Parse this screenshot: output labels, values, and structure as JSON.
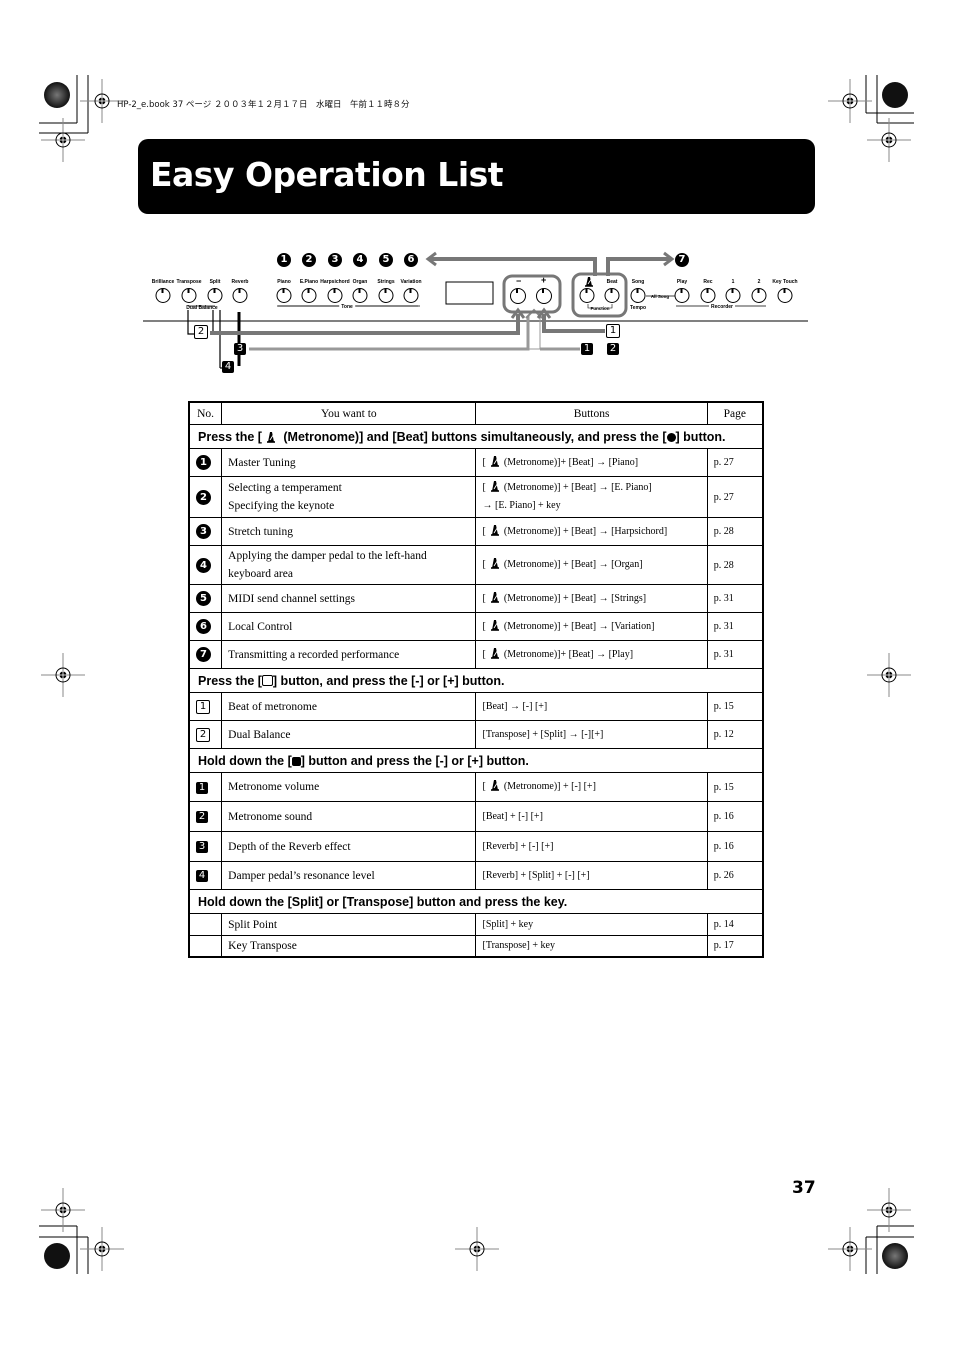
{
  "print_header": "HP-2_e.book  37 ページ  ２００３年１２月１７日　水曜日　午前１１時８分",
  "title": "Easy Operation List",
  "page_number": "37",
  "panel": {
    "left_knobs": [
      "Brilliance",
      "Transpose",
      "Split",
      "Reverb"
    ],
    "left_group_label": "Dual Balance",
    "tone_knobs": [
      "Piano",
      "E.Piano",
      "Harpsichord",
      "Organ",
      "Strings",
      "Variation"
    ],
    "tone_group_label": "Tone",
    "minus_label": "−",
    "plus_label": "+",
    "beat_label": "Beat",
    "function_label": "Function",
    "song_label": "Song",
    "tempo_label": "Tempo",
    "allsong_label": "All Song",
    "recorder_knobs": [
      "Play",
      "Rec",
      "1",
      "2"
    ],
    "recorder_group_label": "Recorder",
    "key_touch_label": "Key Touch",
    "callout_numbers": [
      "1",
      "2",
      "3",
      "4",
      "5",
      "6"
    ],
    "callout_7": "7",
    "callout_outline": [
      "2",
      "1"
    ],
    "callout_filled": [
      "3",
      "4",
      "1",
      "2"
    ]
  },
  "table": {
    "headers": [
      "No.",
      "You want to",
      "Buttons",
      "Page"
    ],
    "sections": [
      {
        "title_pre": "Press the [",
        "title_mid": " (Metronome)] and [Beat] buttons simultaneously, and press the [",
        "title_post": "] button.",
        "rows": [
          {
            "no": "1",
            "want": [
              "Master Tuning"
            ],
            "buttons": [
              "(Metronome)]+ [Beat] → [Piano]"
            ],
            "page": "p. 27"
          },
          {
            "no": "2",
            "want": [
              "Selecting a temperament",
              "Specifying the keynote"
            ],
            "buttons": [
              "(Metronome)] + [Beat] → [E. Piano]",
              "→ [E. Piano] + key"
            ],
            "page": "p. 27"
          },
          {
            "no": "3",
            "want": [
              "Stretch tuning"
            ],
            "buttons": [
              "(Metronome)] + [Beat] → [Harpsichord]"
            ],
            "page": "p. 28"
          },
          {
            "no": "4",
            "want": [
              "Applying the damper pedal to the left-hand",
              "keyboard area"
            ],
            "buttons": [
              "(Metronome)] + [Beat] → [Organ]"
            ],
            "page": "p. 28"
          },
          {
            "no": "5",
            "want": [
              "MIDI send channel settings"
            ],
            "buttons": [
              "(Metronome)] + [Beat] → [Strings]"
            ],
            "page": "p. 31"
          },
          {
            "no": "6",
            "want": [
              "Local Control"
            ],
            "buttons": [
              "(Metronome)] + [Beat] → [Variation]"
            ],
            "page": "p. 31"
          },
          {
            "no": "7",
            "want": [
              "Transmitting a recorded performance"
            ],
            "buttons": [
              "(Metronome)]+ [Beat] → [Play]"
            ],
            "page": "p. 31"
          }
        ]
      },
      {
        "title_pre": "Press the [",
        "title_post": "] button, and press the [-] or [+] button.",
        "rows": [
          {
            "no": "1",
            "want": [
              "Beat of metronome"
            ],
            "buttons": [
              "[Beat] → [-] [+]"
            ],
            "page": "p. 15"
          },
          {
            "no": "2",
            "want": [
              "Dual Balance"
            ],
            "buttons": [
              "[Transpose] + [Split] → [-][+]"
            ],
            "page": "p. 12"
          }
        ]
      },
      {
        "title_pre": "Hold down the [",
        "title_post": "] button and press the [-] or [+] button.",
        "rows": [
          {
            "no": "1",
            "want": [
              "Metronome volume"
            ],
            "buttons": [
              "(Metronome)] + [-] [+]"
            ],
            "page": "p. 15"
          },
          {
            "no": "2",
            "want": [
              "Metronome sound"
            ],
            "buttons": [
              "[Beat] + [-] [+]"
            ],
            "page": "p. 16"
          },
          {
            "no": "3",
            "want": [
              "Depth of the Reverb effect"
            ],
            "buttons": [
              "[Reverb] + [-] [+]"
            ],
            "page": "p. 16"
          },
          {
            "no": "4",
            "want": [
              "Damper pedal’s resonance level"
            ],
            "buttons": [
              "[Reverb] + [Split] + [-] [+]"
            ],
            "page": "p. 26"
          }
        ]
      },
      {
        "title": "Hold down the [Split] or [Transpose] button and press the key.",
        "rows": [
          {
            "no": "",
            "want": [
              "Split Point"
            ],
            "buttons": [
              "[Split] + key"
            ],
            "page": "p. 14"
          },
          {
            "no": "",
            "want": [
              "Key Transpose"
            ],
            "buttons": [
              "[Transpose] + key"
            ],
            "page": "p. 17"
          }
        ]
      }
    ]
  }
}
